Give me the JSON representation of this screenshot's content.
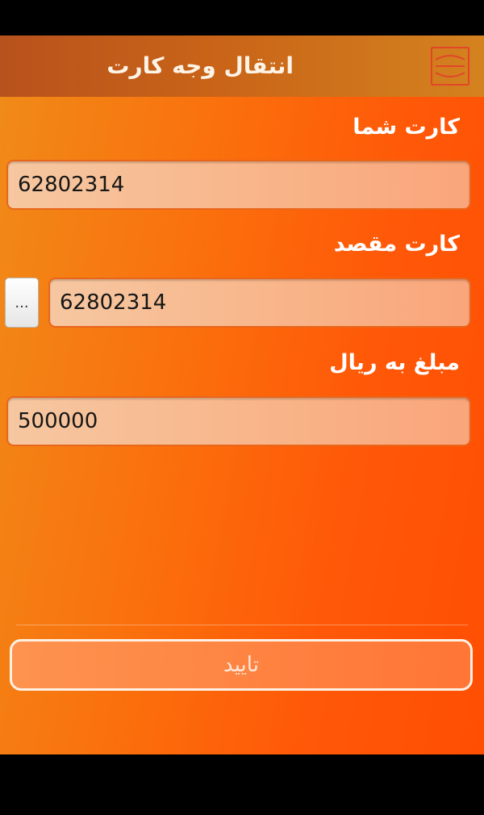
{
  "header": {
    "title": "انتقال وجه کارت",
    "menu_icon": "menu-icon"
  },
  "form": {
    "source_card": {
      "label": "کارت شما",
      "value": "62802314"
    },
    "destination_card": {
      "label": "کارت مقصد",
      "value": "62802314",
      "picker_label": "..."
    },
    "amount": {
      "label": "مبلغ به ریال",
      "value": "500000"
    }
  },
  "actions": {
    "confirm_label": "تایید"
  },
  "colors": {
    "accent": "#ff5a0a",
    "header": "#c96418",
    "menu_border": "#e2462a"
  }
}
